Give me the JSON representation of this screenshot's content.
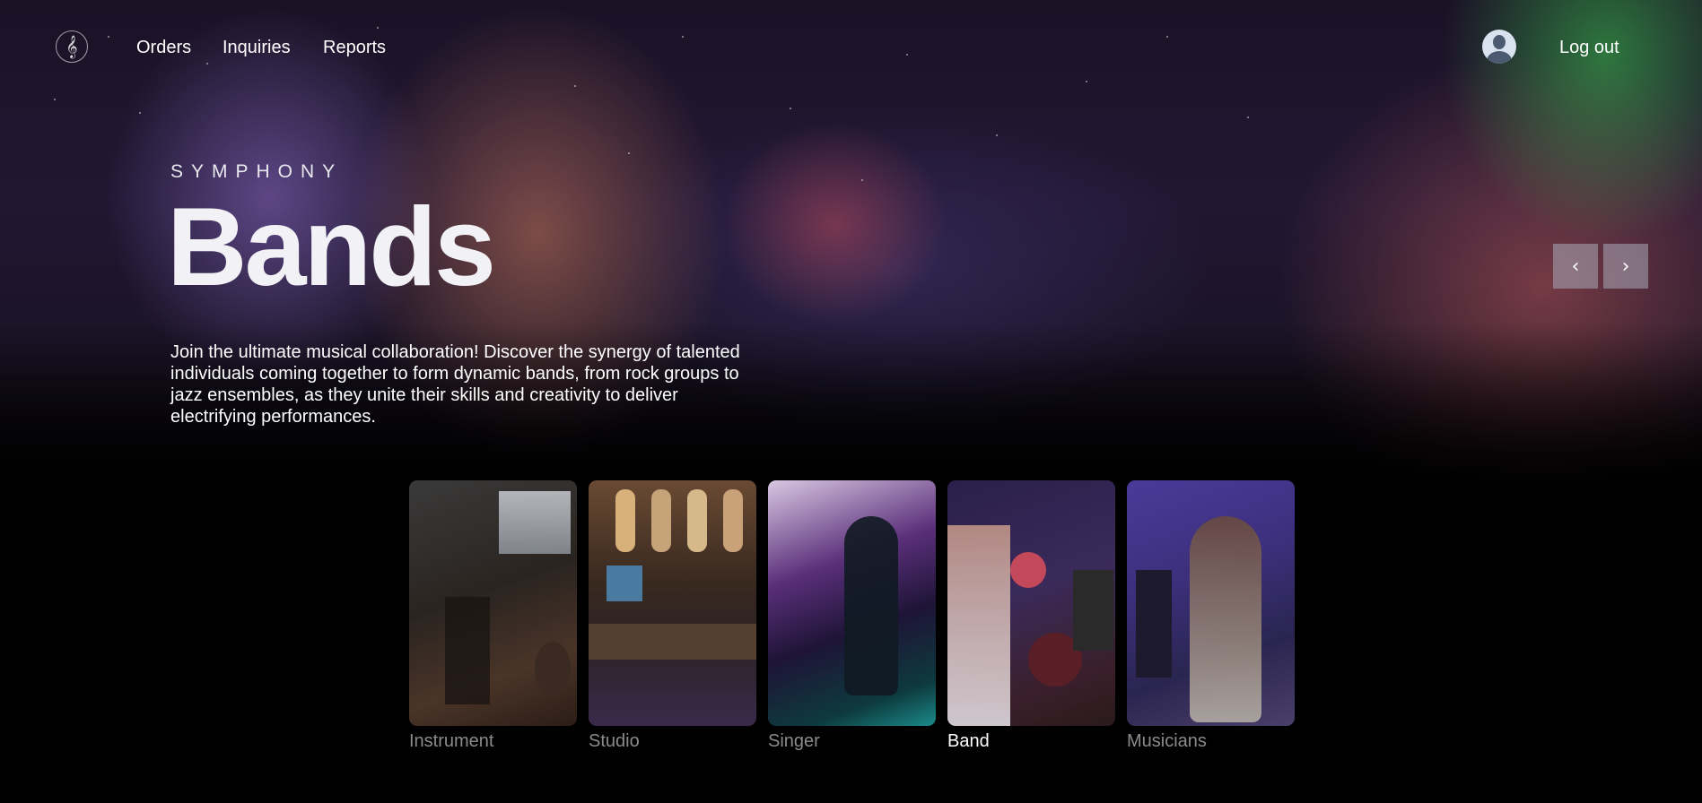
{
  "nav": {
    "logo_glyph": "𝄞",
    "links": [
      "Orders",
      "Inquiries",
      "Reports"
    ],
    "logout_label": "Log out"
  },
  "hero": {
    "eyebrow": "SYMPHONY",
    "title": "Bands",
    "description": "Join the ultimate musical collaboration! Discover the synergy of talented individuals coming together to form dynamic bands, from rock groups to jazz ensembles, as they unite their skills and creativity to deliver electrifying performances.",
    "prev_glyph": "‹",
    "next_glyph": "›"
  },
  "categories": [
    {
      "label": "Instrument",
      "active": false
    },
    {
      "label": "Studio",
      "active": false
    },
    {
      "label": "Singer",
      "active": false
    },
    {
      "label": "Band",
      "active": true
    },
    {
      "label": "Musicians",
      "active": false
    }
  ],
  "colors": {
    "background": "#000000",
    "active_label": "#ffffff",
    "inactive_label": "#8b8b8f",
    "arrow_bg": "#a9a9b8"
  }
}
